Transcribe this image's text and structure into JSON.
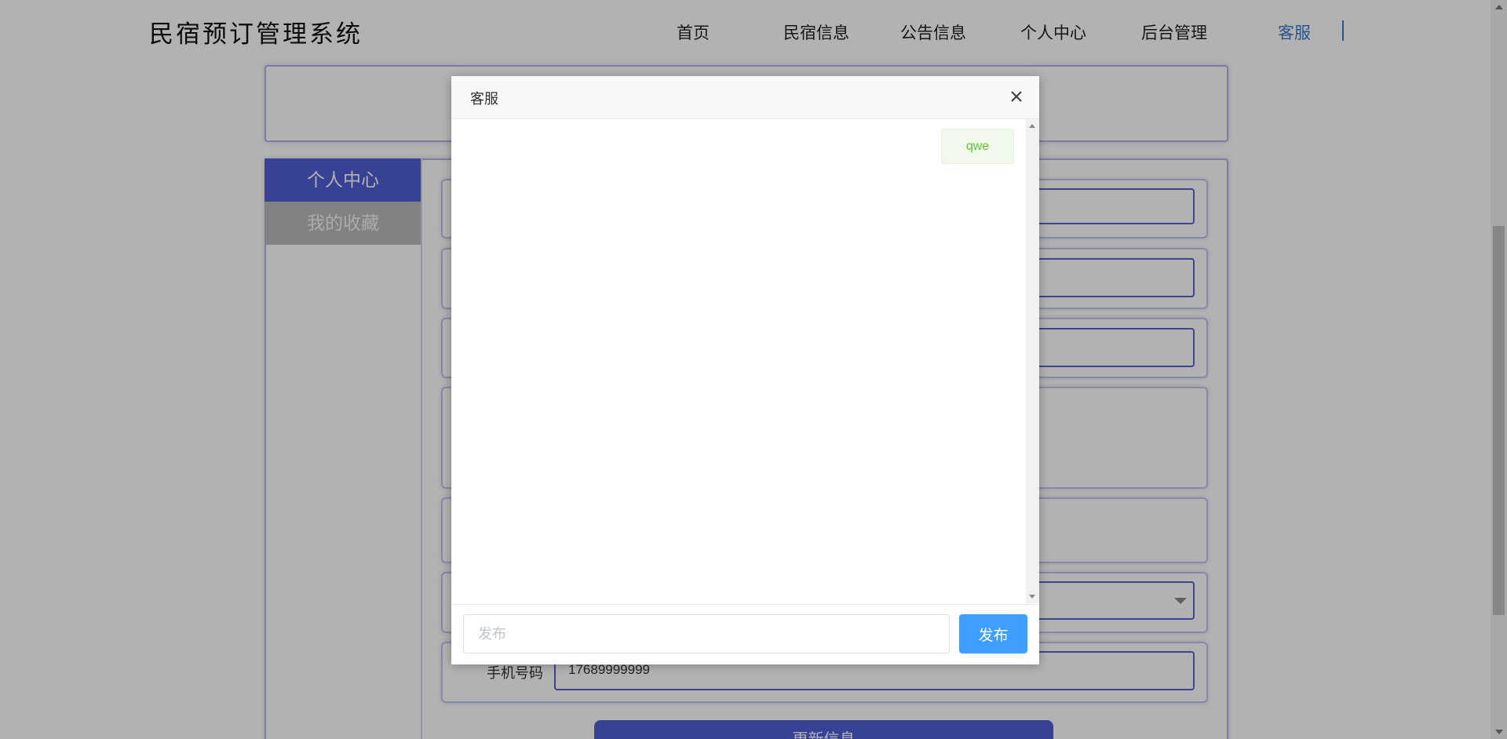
{
  "header": {
    "logo": "民宿预订管理系统",
    "nav": [
      {
        "label": "首页"
      },
      {
        "label": "民宿信息"
      },
      {
        "label": "公告信息"
      },
      {
        "label": "个人中心"
      },
      {
        "label": "后台管理"
      },
      {
        "label": "客服"
      }
    ],
    "active_nav": "客服"
  },
  "sidebar": {
    "items": [
      {
        "label": "个人中心"
      },
      {
        "label": "我的收藏"
      }
    ]
  },
  "form": {
    "phone_label": "手机号码",
    "phone_value": "17689999999",
    "update_button": "更新信息"
  },
  "dialog": {
    "title": "客服",
    "messages": [
      {
        "text": "qwe",
        "side": "right"
      }
    ],
    "input_placeholder": "发布",
    "send_label": "发布"
  },
  "colors": {
    "accent": "#409eff",
    "nav_active": "#3c79c9",
    "sidebar_active": "#505fd6",
    "message_text": "#67c23a",
    "message_bg": "#f0f9eb"
  }
}
